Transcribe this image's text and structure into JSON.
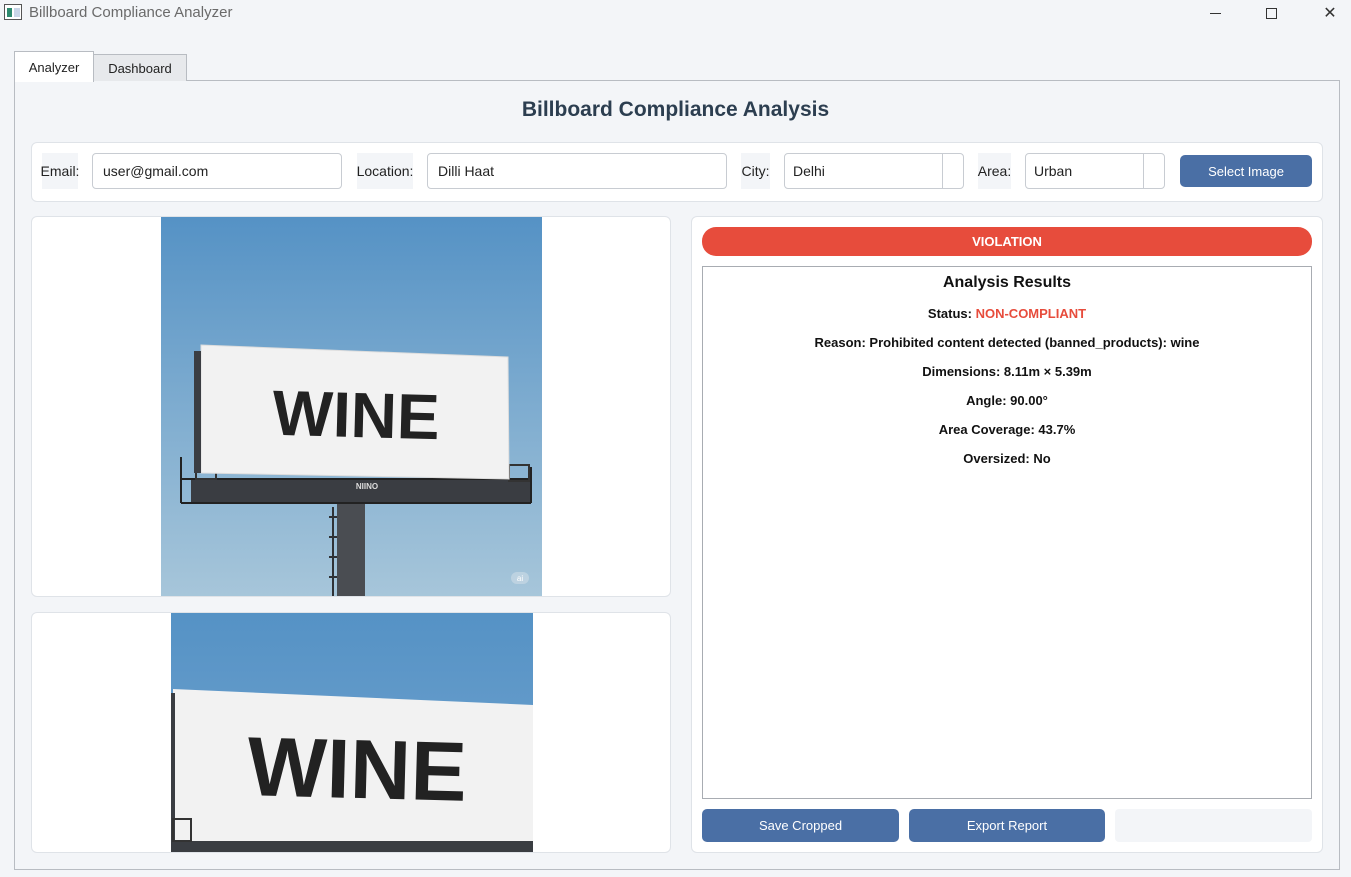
{
  "window": {
    "title": "Billboard Compliance Analyzer"
  },
  "tabs": [
    {
      "label": "Analyzer",
      "active": true
    },
    {
      "label": "Dashboard",
      "active": false
    }
  ],
  "page_title": "Billboard Compliance Analysis",
  "form": {
    "email": {
      "label": "Email:",
      "value": "user@gmail.com"
    },
    "location": {
      "label": "Location:",
      "value": "Dilli Haat"
    },
    "city": {
      "label": "City:",
      "value": "Delhi"
    },
    "area": {
      "label": "Area:",
      "value": "Urban"
    },
    "select_image_label": "Select Image"
  },
  "images": {
    "original": {
      "billboard_text": "WINE",
      "brand_text": "NIINO",
      "watermark": "ai"
    },
    "cropped": {
      "billboard_text": "WINE"
    }
  },
  "results": {
    "banner": "VIOLATION",
    "title": "Analysis Results",
    "status_label": "Status:",
    "status_value": "NON-COMPLIANT",
    "reason": "Reason: Prohibited content detected (banned_products): wine",
    "dimensions": "Dimensions: 8.11m × 5.39m",
    "angle": "Angle: 90.00°",
    "area_coverage": "Area Coverage: 43.7%",
    "oversized": "Oversized: No"
  },
  "actions": {
    "save_cropped_label": "Save Cropped",
    "export_report_label": "Export Report"
  },
  "colors": {
    "accent": "#4a6fa5",
    "violation": "#e74c3c",
    "title": "#2c3e50"
  }
}
